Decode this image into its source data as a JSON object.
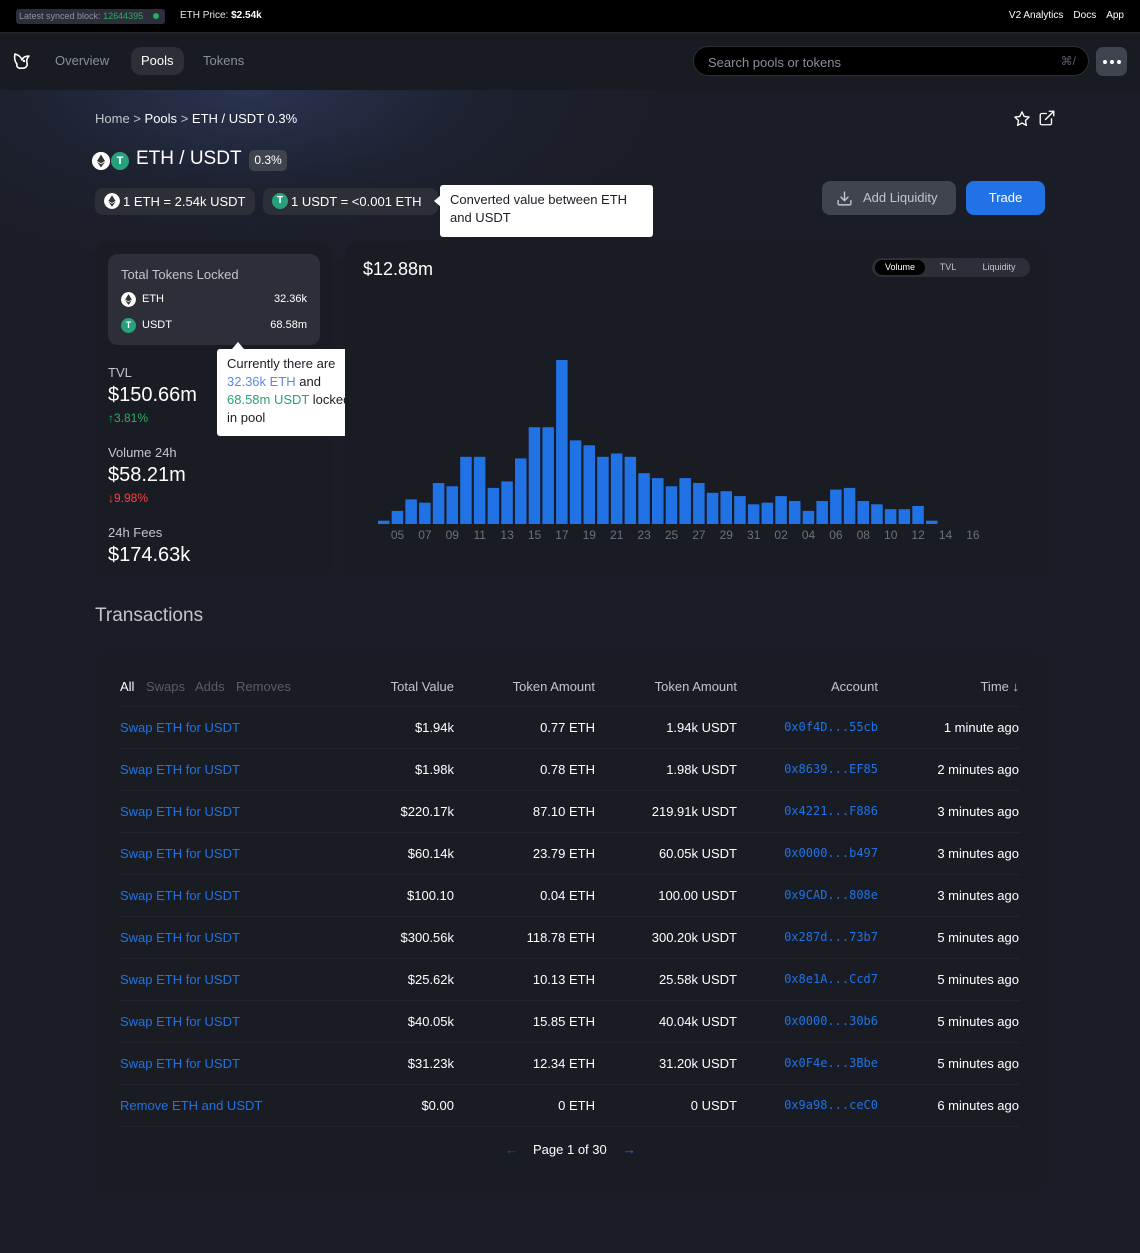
{
  "topbar": {
    "sync_label": "Latest synced block:",
    "sync_block": "12644395",
    "eth_price_label": "ETH Price:",
    "eth_price_value": "$2.54k",
    "links": [
      "V2 Analytics",
      "Docs",
      "App"
    ]
  },
  "nav": {
    "tabs": [
      "Overview",
      "Pools",
      "Tokens"
    ],
    "active_tab": "Pools",
    "search_placeholder": "Search pools or tokens",
    "search_shortcut": "⌘/"
  },
  "breadcrumb": {
    "home": "Home",
    "sep": ">",
    "pools": "Pools",
    "current": "ETH / USDT 0.3%"
  },
  "pool": {
    "title": "ETH / USDT",
    "fee_tier": "0.3%",
    "rate_1": "1 ETH = 2.54k USDT",
    "rate_2": "1 USDT = <0.001 ETH",
    "tooltip_conversion": "Converted value between ETH and USDT",
    "add_liquidity": "Add Liquidity",
    "trade": "Trade"
  },
  "locked": {
    "title": "Total Tokens Locked",
    "tokens": [
      {
        "symbol": "ETH",
        "amount": "32.36k"
      },
      {
        "symbol": "USDT",
        "amount": "68.58m"
      }
    ],
    "tooltip_prefix": "Currently there are",
    "tooltip_eth": "32.36k ETH",
    "tooltip_and": "and",
    "tooltip_usdt": "68.58m USDT",
    "tooltip_suffix_1": "locked",
    "tooltip_suffix_2": "in pool"
  },
  "stats": {
    "tvl_label": "TVL",
    "tvl_value": "$150.66m",
    "tvl_change": "3.81%",
    "vol_label": "Volume 24h",
    "vol_value": "$58.21m",
    "vol_change": "9.98%",
    "fees_label": "24h Fees",
    "fees_value": "$174.63k"
  },
  "chart_header": {
    "value": "$12.88m",
    "toggle": [
      "Volume",
      "TVL",
      "Liquidity"
    ],
    "active_toggle": "Volume"
  },
  "chart_data": {
    "type": "bar",
    "title": "",
    "series": [
      {
        "name": "Volume",
        "color": "#2172e5"
      }
    ],
    "x_tick_labels": [
      "05",
      "07",
      "09",
      "11",
      "13",
      "15",
      "17",
      "19",
      "21",
      "23",
      "25",
      "27",
      "29",
      "31",
      "02",
      "04",
      "06",
      "08",
      "10",
      "12",
      "14",
      "16"
    ],
    "values_relative": [
      0.02,
      0.08,
      0.15,
      0.13,
      0.25,
      0.23,
      0.41,
      0.41,
      0.22,
      0.26,
      0.4,
      0.59,
      0.59,
      1.0,
      0.51,
      0.48,
      0.41,
      0.43,
      0.41,
      0.31,
      0.28,
      0.23,
      0.28,
      0.25,
      0.19,
      0.2,
      0.17,
      0.12,
      0.13,
      0.17,
      0.14,
      0.08,
      0.14,
      0.21,
      0.22,
      0.14,
      0.12,
      0.09,
      0.09,
      0.11,
      0.02
    ],
    "grid": false
  },
  "transactions": {
    "title": "Transactions",
    "filters": [
      "All",
      "Swaps",
      "Adds",
      "Removes"
    ],
    "active_filter": "All",
    "headers": [
      "Total Value",
      "Token Amount",
      "Token Amount",
      "Account",
      "Time ↓"
    ],
    "rows": [
      {
        "type": "Swap ETH for USDT",
        "value": "$1.94k",
        "token0": "0.77 ETH",
        "token1": "1.94k USDT",
        "account": "0x0f4D...55cb",
        "time": "1 minute ago"
      },
      {
        "type": "Swap ETH for USDT",
        "value": "$1.98k",
        "token0": "0.78 ETH",
        "token1": "1.98k USDT",
        "account": "0x8639...EF85",
        "time": "2 minutes ago"
      },
      {
        "type": "Swap ETH for USDT",
        "value": "$220.17k",
        "token0": "87.10 ETH",
        "token1": "219.91k USDT",
        "account": "0x4221...F886",
        "time": "3 minutes ago"
      },
      {
        "type": "Swap ETH for USDT",
        "value": "$60.14k",
        "token0": "23.79 ETH",
        "token1": "60.05k USDT",
        "account": "0x0000...b497",
        "time": "3 minutes ago"
      },
      {
        "type": "Swap ETH for USDT",
        "value": "$100.10",
        "token0": "0.04 ETH",
        "token1": "100.00 USDT",
        "account": "0x9CAD...808e",
        "time": "3 minutes ago"
      },
      {
        "type": "Swap ETH for USDT",
        "value": "$300.56k",
        "token0": "118.78 ETH",
        "token1": "300.20k USDT",
        "account": "0x287d...73b7",
        "time": "5 minutes ago"
      },
      {
        "type": "Swap ETH for USDT",
        "value": "$25.62k",
        "token0": "10.13 ETH",
        "token1": "25.58k USDT",
        "account": "0x8e1A...Ccd7",
        "time": "5 minutes ago"
      },
      {
        "type": "Swap ETH for USDT",
        "value": "$40.05k",
        "token0": "15.85 ETH",
        "token1": "40.04k USDT",
        "account": "0x0000...30b6",
        "time": "5 minutes ago"
      },
      {
        "type": "Swap ETH for USDT",
        "value": "$31.23k",
        "token0": "12.34 ETH",
        "token1": "31.20k USDT",
        "account": "0x0F4e...3Bbe",
        "time": "5 minutes ago"
      },
      {
        "type": "Remove ETH and USDT",
        "value": "$0.00",
        "token0": "0 ETH",
        "token1": "0 USDT",
        "account": "0x9a98...ceC0",
        "time": "6 minutes ago"
      }
    ],
    "pager": {
      "prev": "←",
      "label": "Page 1 of 30",
      "next": "→"
    }
  },
  "colors": {
    "accent": "#2172e5",
    "positive": "#27ae60",
    "negative": "#fd4040",
    "usdt": "#26a17b"
  }
}
